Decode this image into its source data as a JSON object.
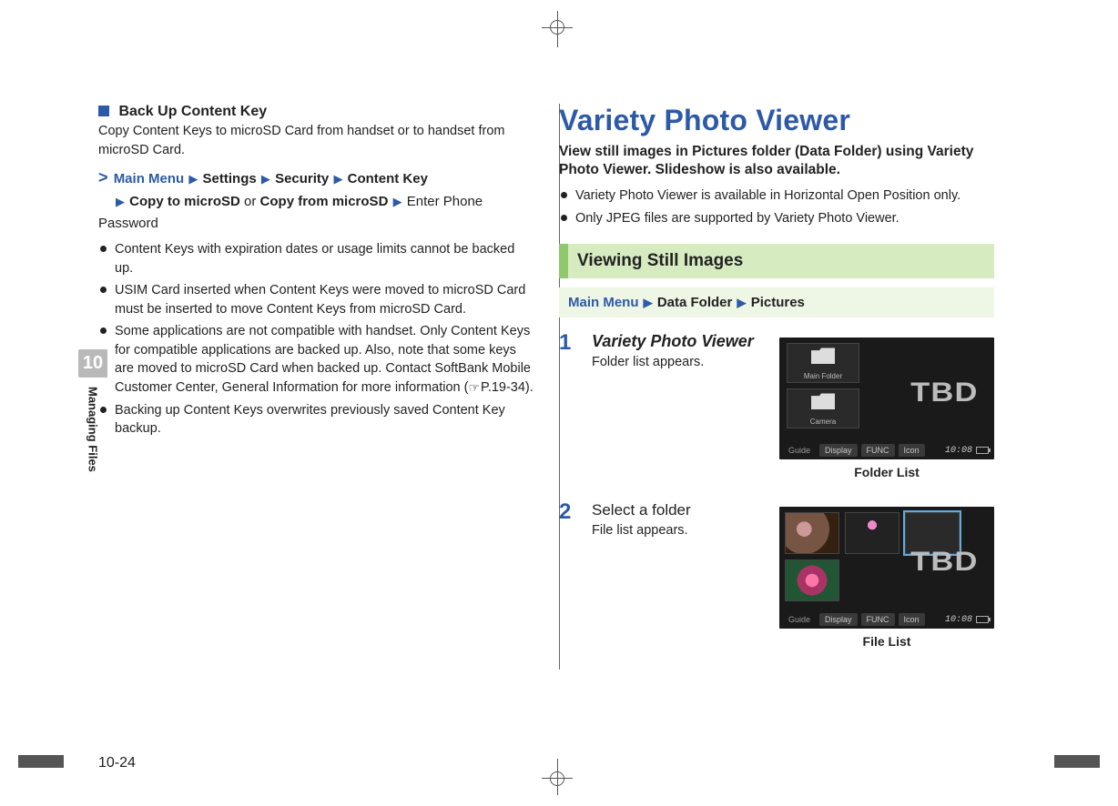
{
  "chapter": {
    "number": "10",
    "label": "Managing Files"
  },
  "left": {
    "heading": "Back Up Content Key",
    "intro": "Copy Content Keys to microSD Card from handset or to handset from microSD Card.",
    "breadcrumb": {
      "start": "Main Menu",
      "items": [
        "Settings",
        "Security",
        "Content Key"
      ],
      "line2_a": "Copy to microSD",
      "line2_or": "or",
      "line2_b": "Copy from microSD",
      "tail": "Enter Phone Password"
    },
    "bullets": [
      "Content Keys with expiration dates or usage limits cannot be backed up.",
      "USIM Card inserted when Content Keys were moved to microSD Card must be inserted to move Content Keys from microSD Card.",
      "Some applications are not compatible with handset. Only Content Keys for compatible applications are backed up. Also, note that some keys are moved to microSD Card when backed up. Contact SoftBank Mobile Customer Center, General Information for more information (P.19-34).",
      "Backing up Content Keys overwrites previously saved Content Key backup."
    ],
    "ref_label": "P.19-34"
  },
  "right": {
    "title": "Variety Photo Viewer",
    "subtitle": "View still images in Pictures folder (Data Folder) using Variety Photo Viewer. Slideshow is also available.",
    "notes": [
      "Variety Photo Viewer is available in Horizontal Open Position only.",
      "Only JPEG files are supported by Variety Photo Viewer."
    ],
    "section": "Viewing Still Images",
    "nav": {
      "start": "Main Menu",
      "items": [
        "Data Folder",
        "Pictures"
      ]
    },
    "steps": [
      {
        "num": "1",
        "head": "Variety Photo Viewer",
        "head_style": "italic-bold",
        "desc": "Folder list appears.",
        "caption": "Folder List",
        "screen": {
          "type": "folder",
          "folders": [
            "Main Folder",
            "Camera"
          ],
          "softkeys": [
            "Guide",
            "Display",
            "FUNC",
            "Icon"
          ],
          "clock": "10:08",
          "tbd": "TBD"
        }
      },
      {
        "num": "2",
        "head": "Select a folder",
        "head_style": "normal",
        "desc": "File list appears.",
        "caption": "File List",
        "screen": {
          "type": "file",
          "softkeys": [
            "Guide",
            "Display",
            "FUNC",
            "Icon"
          ],
          "clock": "10:08",
          "tbd": "TBD"
        }
      }
    ]
  },
  "page_number": "10-24"
}
